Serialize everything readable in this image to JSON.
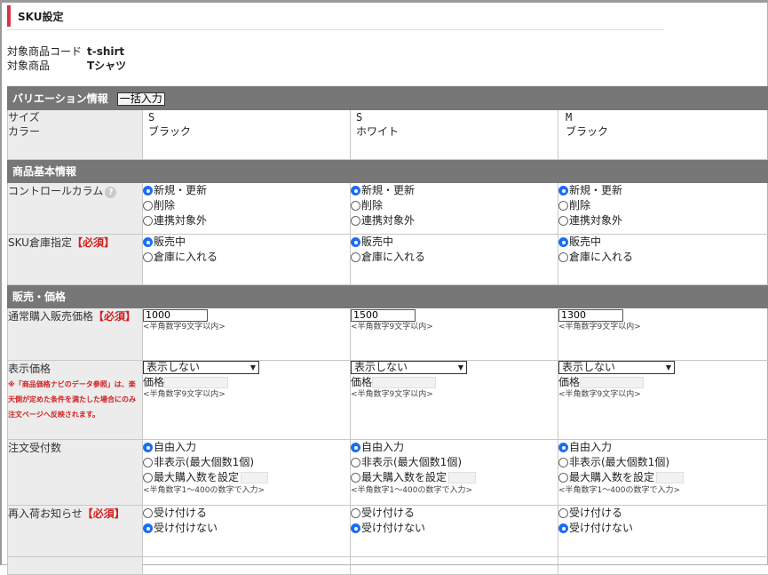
{
  "page_title": "SKU設定",
  "product": {
    "code_label": "対象商品コード",
    "code_value": "t-shirt",
    "name_label": "対象商品",
    "name_value": "Tシャツ"
  },
  "variation": {
    "header": "バリエーション情報",
    "bulk_button": "一括入力",
    "size_label": "サイズ",
    "color_label": "カラー",
    "columns": [
      {
        "size": "S",
        "color": "ブラック"
      },
      {
        "size": "S",
        "color": "ホワイト"
      },
      {
        "size": "M",
        "color": "ブラック"
      }
    ]
  },
  "basic": {
    "header": "商品基本情報",
    "control_label": "コントロールカラム",
    "help_icon": "?",
    "control_options": [
      "新規・更新",
      "削除",
      "連携対象外"
    ],
    "control_selected": [
      0,
      0,
      0
    ],
    "warehouse_label": "SKU倉庫指定",
    "required_mark": "【必須】",
    "warehouse_options": [
      "販売中",
      "倉庫に入れる"
    ],
    "warehouse_selected": [
      0,
      0,
      0
    ]
  },
  "sales": {
    "header": "販売・価格",
    "price_label": "通常購入販売価格",
    "required_mark": "【必須】",
    "prices": [
      "1000",
      "1500",
      "1300"
    ],
    "price_hint": "<半角数字9文字以内>",
    "display_label": "表示価格",
    "display_note": "※「商品価格ナビのデータ参照」は、楽天側が定めた条件を満たした場合にのみ注文ページへ反映されます。",
    "display_select": [
      "表示しない",
      "表示しない",
      "表示しない"
    ],
    "display_price_label": "価格",
    "display_hint": "<半角数字9文字以内>",
    "order_label": "注文受付数",
    "order_options": [
      "自由入力",
      "非表示(最大個数1個)",
      "最大購入数を設定"
    ],
    "order_selected": [
      0,
      0,
      0
    ],
    "order_hint": "<半角数字1～400の数字で入力>",
    "restock_label": "再入荷お知らせ",
    "restock_required": "【必須】",
    "restock_options": [
      "受け付ける",
      "受け付けない"
    ],
    "restock_selected": [
      1,
      1,
      1
    ]
  }
}
